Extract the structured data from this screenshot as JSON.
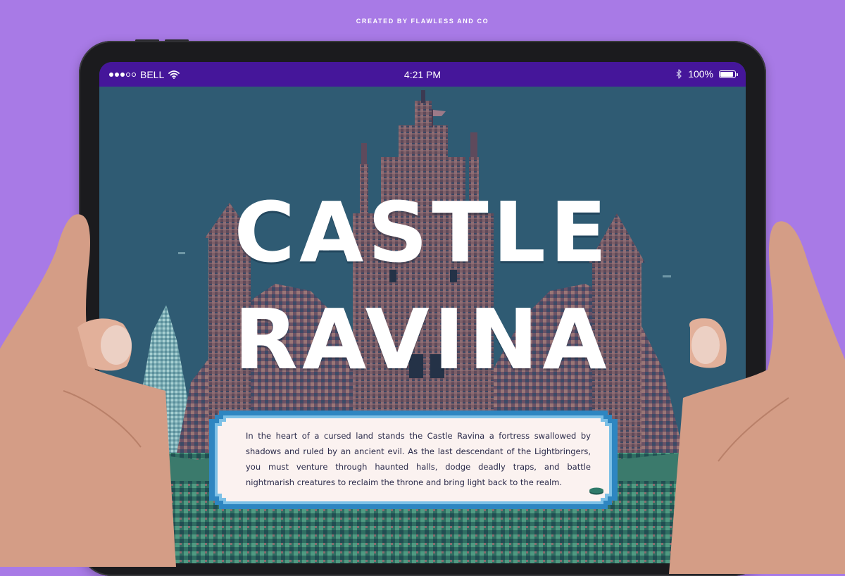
{
  "credit": "CREATED BY FLAWLESS AND CO",
  "status_bar": {
    "carrier": "BELL",
    "time": "4:21 PM",
    "battery": "100%",
    "battery_level": 1.0,
    "signal_bars_filled": 3,
    "signal_bars_total": 5,
    "icons": [
      "signal-dots-icon",
      "wifi-icon",
      "bluetooth-icon",
      "battery-icon"
    ]
  },
  "game": {
    "title_line_1": "CASTLE",
    "title_line_2": "RAVINA",
    "story": "In the heart of a cursed land stands the Castle Ravina a fortress swallowed by shadows and ruled by an ancient evil. As the last descendant of the Lightbringers, you must venture through haunted halls, dodge deadly traps, and battle nightmarish creatures to reclaim the throne and bring light back to the realm."
  },
  "colors": {
    "background": "#a87ae6",
    "status_bar": "#45169a",
    "sky": "#2f5b73",
    "dialog_border": "#2e86c1",
    "dialog_fill": "#fbf2f0",
    "title_text": "#ffffff",
    "coin": "#2f7a6a"
  }
}
